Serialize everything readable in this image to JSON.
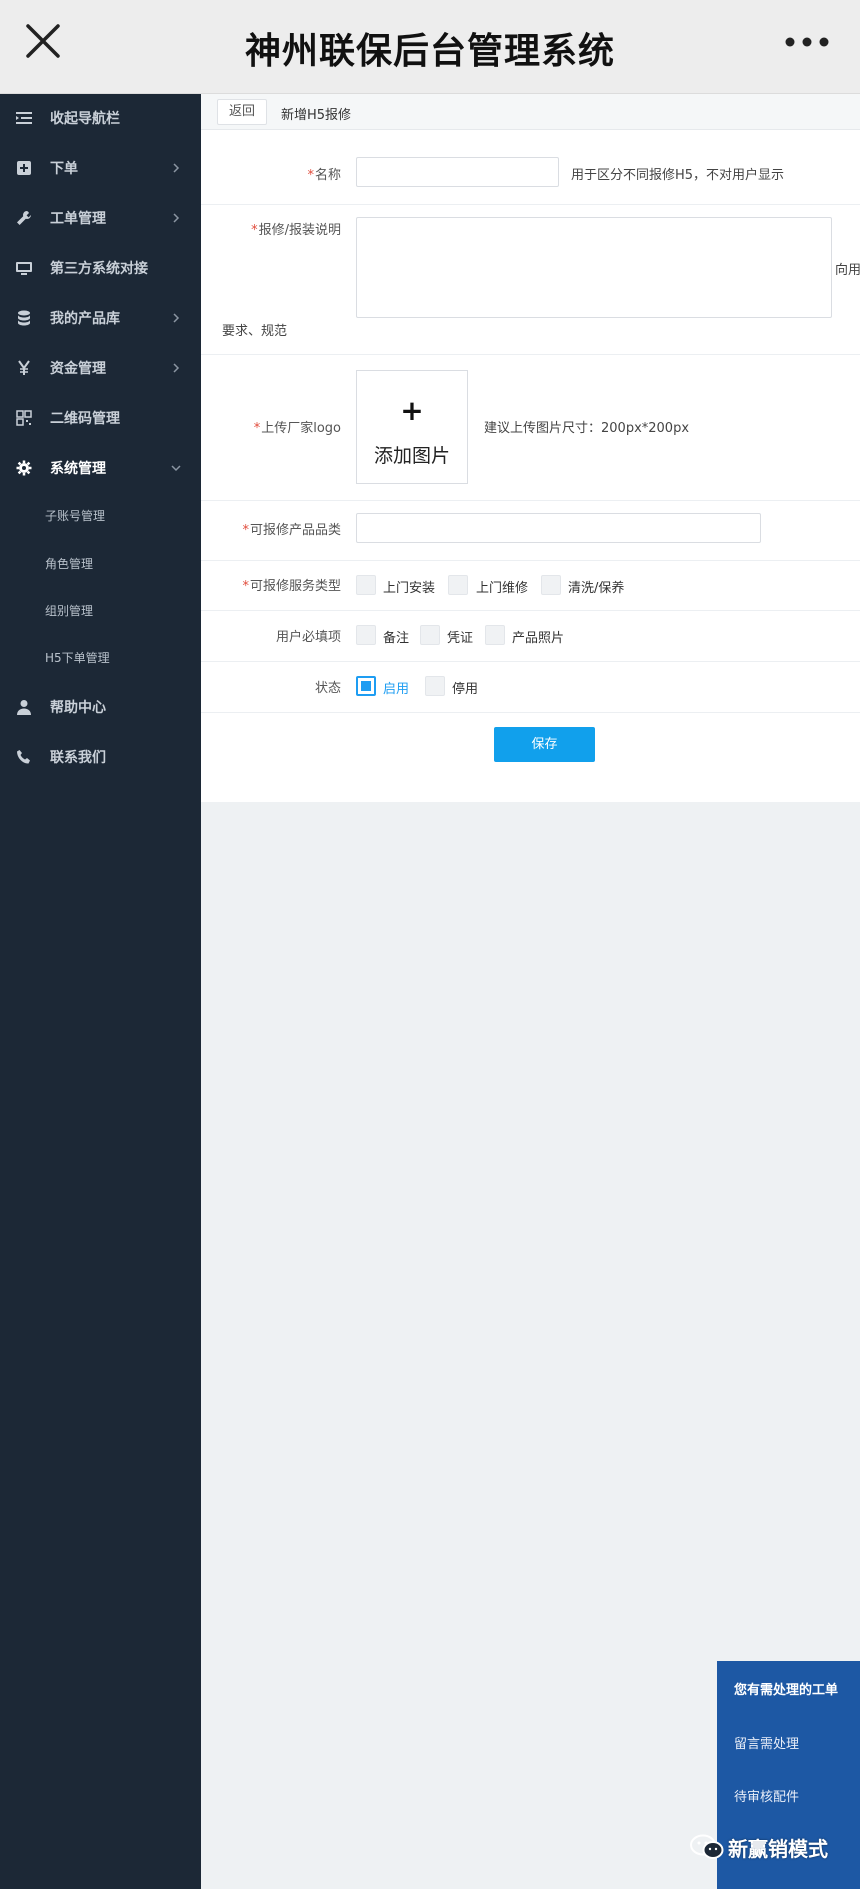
{
  "window": {
    "title": "神州联保后台管理系统"
  },
  "sidebar": {
    "items": [
      {
        "label": "收起导航栏",
        "icon": "list-indent-icon"
      },
      {
        "label": "下单",
        "icon": "plus-square-icon"
      },
      {
        "label": "工单管理",
        "icon": "wrench-icon"
      },
      {
        "label": "第三方系统对接",
        "icon": "monitor-icon"
      },
      {
        "label": "我的产品库",
        "icon": "database-icon"
      },
      {
        "label": "资金管理",
        "icon": "yen-icon"
      },
      {
        "label": "二维码管理",
        "icon": "qrcode-icon"
      },
      {
        "label": "系统管理",
        "icon": "gear-icon"
      },
      {
        "label": "帮助中心",
        "icon": "user-icon"
      },
      {
        "label": "联系我们",
        "icon": "phone-icon"
      }
    ],
    "sub_items": [
      "子账号管理",
      "角色管理",
      "组别管理",
      "H5下单管理"
    ]
  },
  "breadcrumb": {
    "back_label": "返回",
    "page_title": "新增H5报修"
  },
  "form": {
    "required_mark": "*",
    "name": {
      "label": "名称",
      "value": "",
      "hint": "用于区分不同报修H5，不对用户显示"
    },
    "description": {
      "label": "报修/报装说明",
      "value": "",
      "hint_right": "向用",
      "hint_below": "要求、规范"
    },
    "logo": {
      "label": "上传厂家logo",
      "button_plus": "+",
      "button_label": "添加图片",
      "hint": "建议上传图片尺寸：200px*200px"
    },
    "category": {
      "label": "可报修产品品类",
      "value": ""
    },
    "service_types": {
      "label": "可报修服务类型",
      "options": [
        {
          "label": "上门安装",
          "checked": false
        },
        {
          "label": "上门维修",
          "checked": false
        },
        {
          "label": "清洗/保养",
          "checked": false
        }
      ]
    },
    "required_fields": {
      "label": "用户必填项",
      "options": [
        {
          "label": "备注",
          "checked": false
        },
        {
          "label": "凭证",
          "checked": false
        },
        {
          "label": "产品照片",
          "checked": false
        }
      ]
    },
    "status": {
      "label": "状态",
      "options": [
        {
          "label": "启用",
          "checked": true
        },
        {
          "label": "停用",
          "checked": false
        }
      ]
    },
    "save_label": "保存"
  },
  "notice": {
    "title": "您有需处理的工单",
    "items": [
      "留言需处理",
      "待审核配件"
    ]
  },
  "watermark": {
    "text": "新赢销模式"
  },
  "colors": {
    "sidebar_bg": "#1c2836",
    "accent": "#11a0ec",
    "notice_bg": "#1d58a4",
    "required": "#e14b3b"
  }
}
